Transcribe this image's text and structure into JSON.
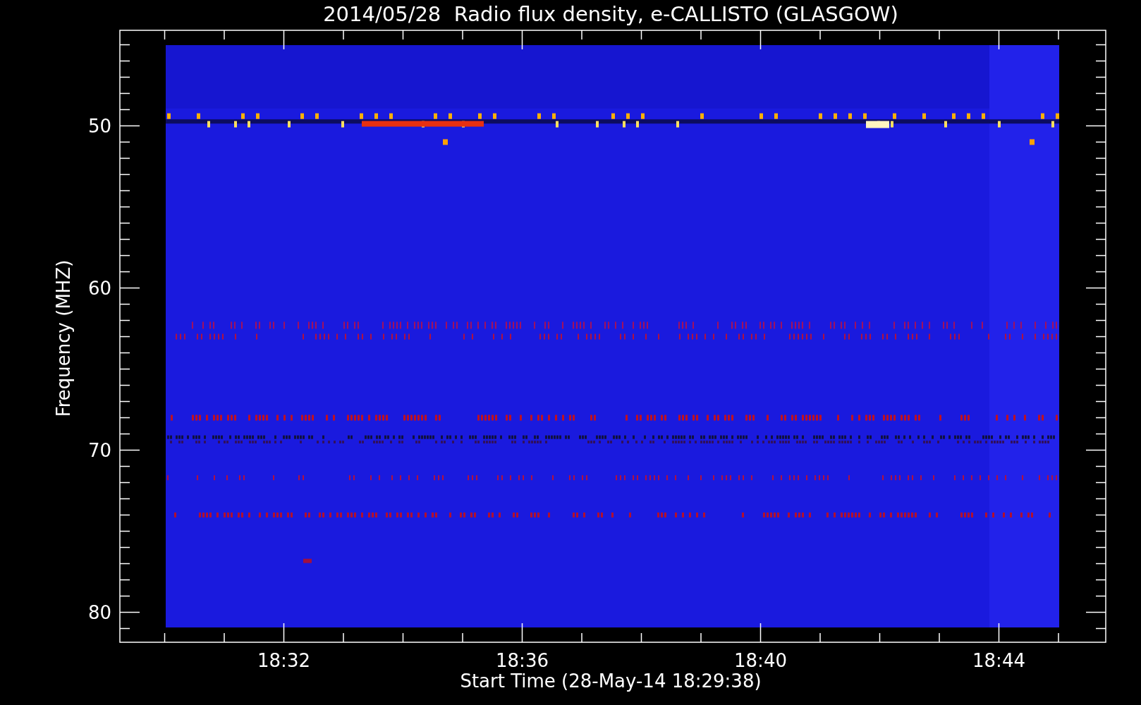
{
  "title": "2014/05/28  Radio flux density, e-CALLISTO (GLASGOW)",
  "y_axis": {
    "label": "Frequency (MHZ)",
    "ticks": [
      "50",
      "60",
      "70",
      "80"
    ]
  },
  "x_axis": {
    "label": "Start Time (28-May-14 18:29:38)",
    "ticks": [
      "18:32",
      "18:36",
      "18:40",
      "18:44"
    ]
  }
}
